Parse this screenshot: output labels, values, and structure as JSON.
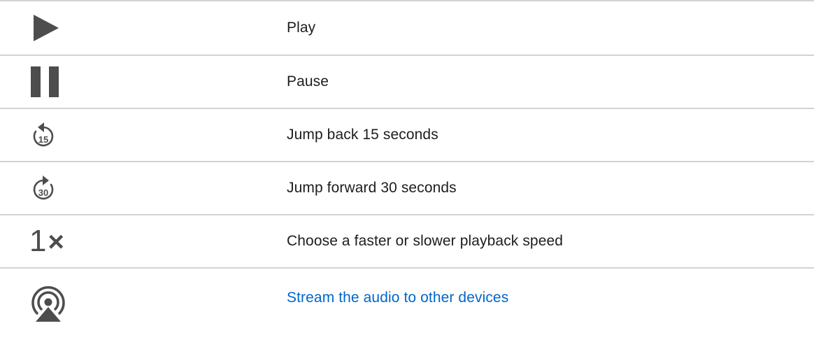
{
  "rows": [
    {
      "icon": "play-icon",
      "label": "Play"
    },
    {
      "icon": "pause-icon",
      "label": "Pause"
    },
    {
      "icon": "jump-back-15-icon",
      "label": "Jump back 15 seconds",
      "icon_text": "15"
    },
    {
      "icon": "jump-forward-30-icon",
      "label": "Jump forward 30 seconds",
      "icon_text": "30"
    },
    {
      "icon": "playback-speed-icon",
      "label": "Choose a faster or slower playback speed",
      "icon_text_one": "1",
      "icon_text_x": "×"
    },
    {
      "icon": "airplay-audio-icon",
      "label": "Stream the audio to other devices"
    }
  ],
  "colors": {
    "icon": "#4d4d4d",
    "link": "#0066cc",
    "divider": "#d2d2d7",
    "text": "#1d1d1f"
  }
}
